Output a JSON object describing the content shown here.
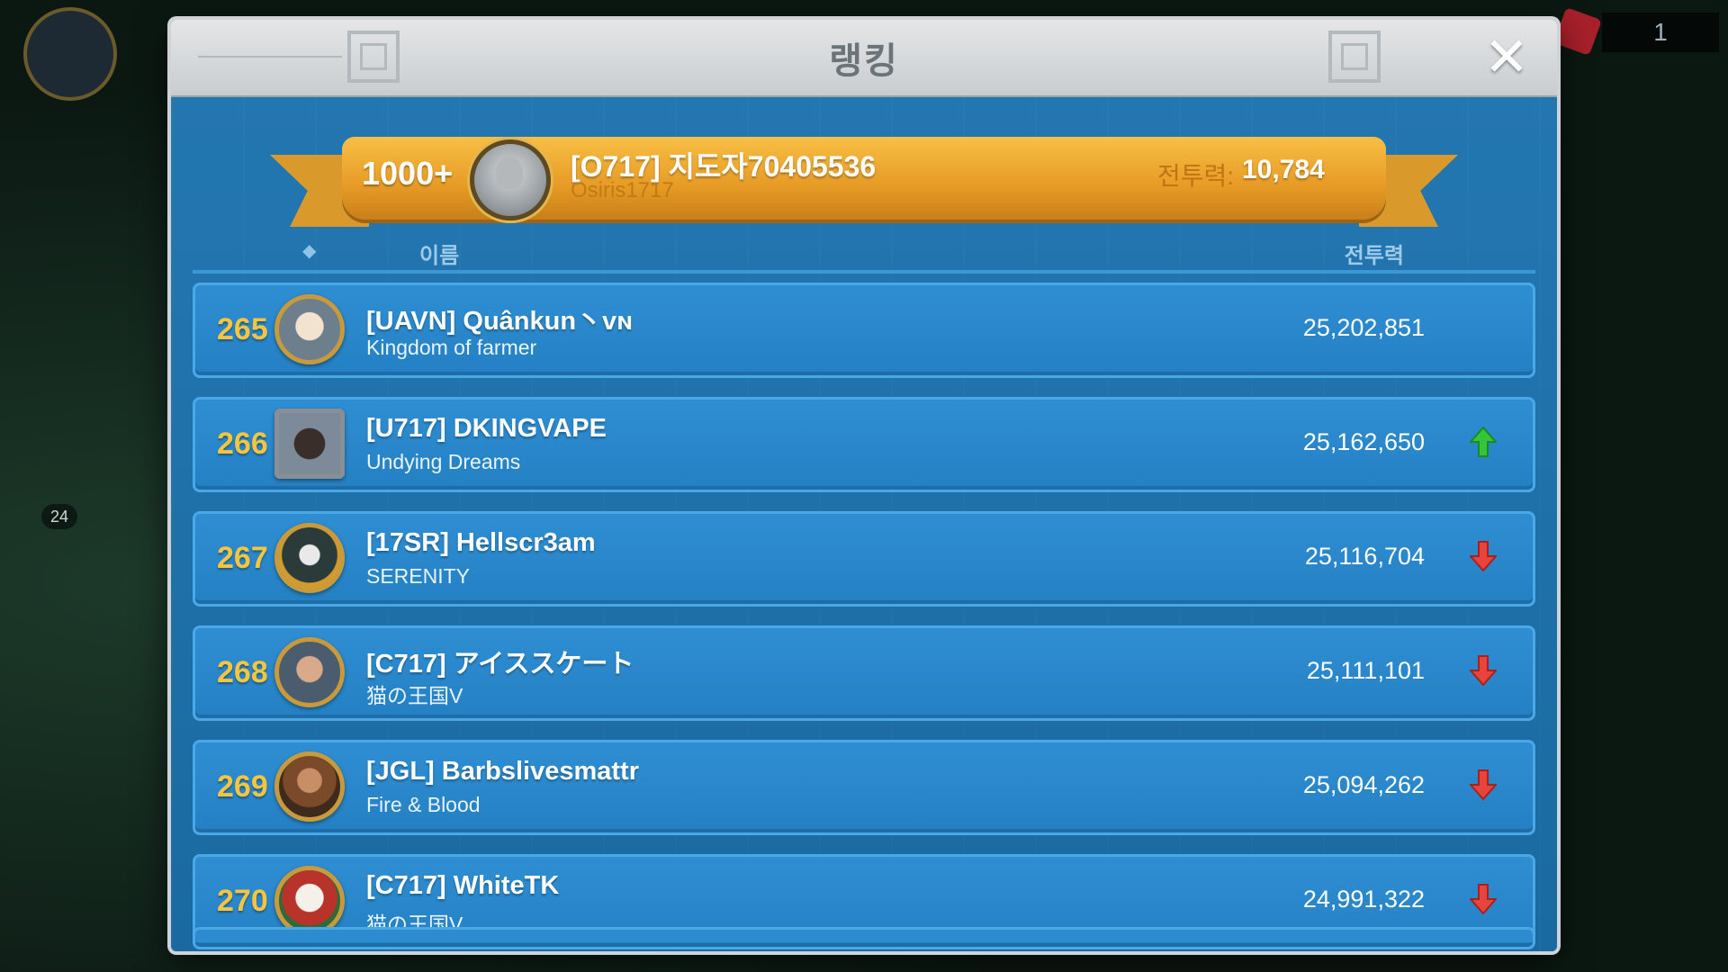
{
  "hud": {
    "counter": "1",
    "badge": "24"
  },
  "modal": {
    "title": "랭킹",
    "close_icon": "close-icon"
  },
  "me": {
    "rank": "1000+",
    "name": "[O717] 지도자70405536",
    "alliance": "Osiris1717",
    "power_label": "전투력:",
    "power": "10,784"
  },
  "columns": {
    "name": "이름",
    "power": "전투력"
  },
  "rows": [
    {
      "rank": "265",
      "name": "[UAVN] Quânkun丶vɴ",
      "alliance": "Kingdom of farmer",
      "power": "25,202,851",
      "trend": "none"
    },
    {
      "rank": "266",
      "name": "[U717] DKINGVAPE",
      "alliance": "Undying Dreams",
      "power": "25,162,650",
      "trend": "up"
    },
    {
      "rank": "267",
      "name": "[17SR] Hellscr3am",
      "alliance": "SERENITY",
      "power": "25,116,704",
      "trend": "down"
    },
    {
      "rank": "268",
      "name": "[C717] アイススケート",
      "alliance": "猫の王国V",
      "power": "25,111,101",
      "trend": "down"
    },
    {
      "rank": "269",
      "name": "[JGL] Barbslivesmattr",
      "alliance": "Fire & Blood",
      "power": "25,094,262",
      "trend": "down"
    },
    {
      "rank": "270",
      "name": "[C717] WhiteTK",
      "alliance": "猫の王国V",
      "power": "24,991,322",
      "trend": "down"
    }
  ],
  "colors": {
    "up": "#34c53a",
    "down": "#e8433c",
    "rank_gold": "#f5c540"
  }
}
